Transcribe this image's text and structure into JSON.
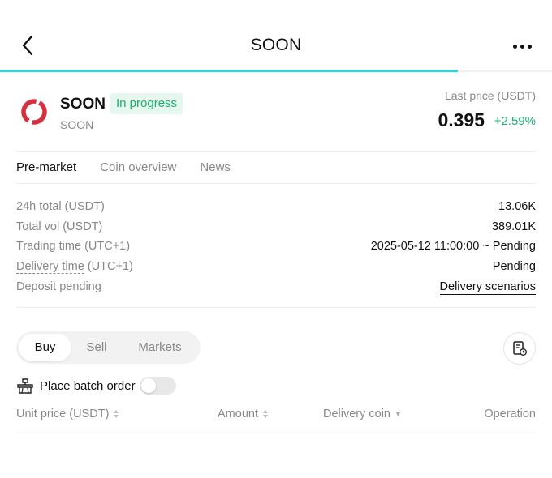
{
  "header": {
    "title": "SOON",
    "progress_fraction": 0.83,
    "accent_color": "#2fd8d8"
  },
  "coin": {
    "name": "SOON",
    "status": "In progress",
    "subtitle": "SOON",
    "price_label": "Last price (USDT)",
    "price": "0.395",
    "change": "+2.59%",
    "logo_color": "#d6303f",
    "up_color": "#1fae6e"
  },
  "tabs": [
    "Pre-market",
    "Coin overview",
    "News"
  ],
  "info": {
    "total_24h_label": "24h total (USDT)",
    "total_24h_value": "13.06K",
    "total_vol_label": "Total vol (USDT)",
    "total_vol_value": "389.01K",
    "trading_time_label": "Trading time (UTC+1)",
    "trading_time_value": "2025-05-12 11:00:00 ~ Pending",
    "delivery_time_label": "Delivery time",
    "delivery_time_suffix": " (UTC+1)",
    "delivery_time_value": "Pending",
    "deposit_label": "Deposit pending",
    "delivery_scenarios_link": "Delivery scenarios"
  },
  "segments": [
    "Buy",
    "Sell",
    "Markets"
  ],
  "batch_order_label": "Place batch order",
  "columns": {
    "unit_price": "Unit price (USDT)",
    "amount": "Amount",
    "delivery_coin": "Delivery coin",
    "operation": "Operation"
  },
  "icons": {
    "back": "chevron-left-icon",
    "more": "more-horizontal-icon",
    "orders": "order-history-icon",
    "batch": "batch-order-icon"
  }
}
